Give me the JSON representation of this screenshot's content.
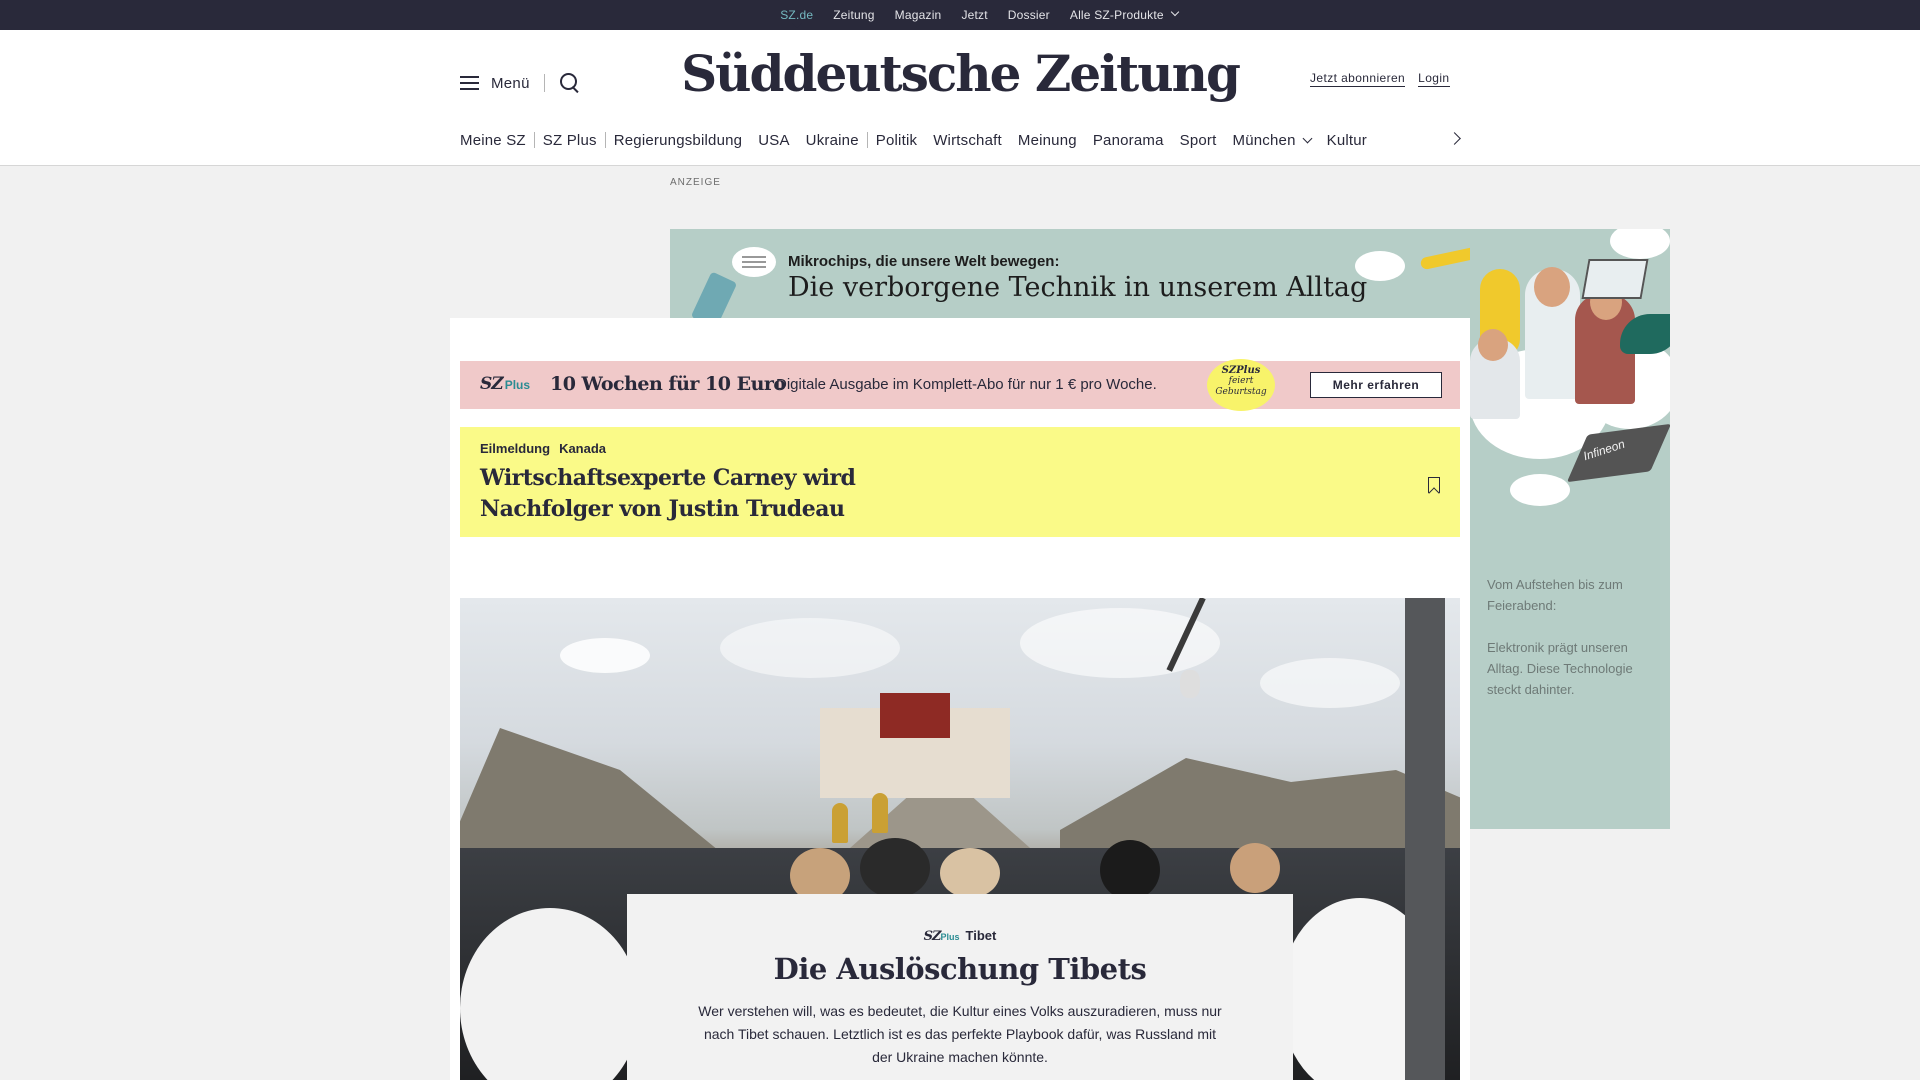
{
  "topbar": {
    "links": [
      {
        "label": "SZ.de",
        "active": true
      },
      {
        "label": "Zeitung"
      },
      {
        "label": "Magazin"
      },
      {
        "label": "Jetzt"
      },
      {
        "label": "Dossier"
      },
      {
        "label": "Alle SZ-Produkte",
        "has_dropdown": true
      }
    ]
  },
  "header": {
    "menu_label": "Menü",
    "logo": "Süddeutsche Zeitung",
    "subscribe_label": "Jetzt abonnieren",
    "login_label": "Login"
  },
  "nav": {
    "items": [
      "Meine SZ",
      "SZ Plus",
      "Regierungsbildung",
      "USA",
      "Ukraine",
      "Politik",
      "Wirtschaft",
      "Meinung",
      "Panorama",
      "Sport",
      "München",
      "Kultur"
    ]
  },
  "ad": {
    "label": "ANZEIGE",
    "leader_small": "Mikrochips, die unsere Welt bewegen:",
    "leader_big": "Die verborgene Technik in unserem Alltag",
    "sky_logo": "Infineon",
    "sky_text_1": "Vom Aufstehen bis zum Feierabend:",
    "sky_text_2": "Elektronik prägt unseren Alltag. Diese Technologie steckt dahinter.",
    "colors": {
      "background": "#b6cec7"
    }
  },
  "promo": {
    "brand": "SZ",
    "brand_suffix": "Plus",
    "title": "10 Wochen für 10 Euro",
    "subtitle": "Digitale Ausgabe im Komplett-Abo für nur 1 € pro Woche.",
    "badge_brand": "SZPlus",
    "badge_text": "feiert Geburtstag",
    "button_label": "Mehr erfahren",
    "colors": {
      "background": "#f0c9c9",
      "badge": "#f8f36a"
    }
  },
  "breaking": {
    "tag": "Eilmeldung",
    "topic": "Kanada",
    "title": "Wirtschaftsexperte Carney wird Nachfolger von Justin Trudeau",
    "colors": {
      "background": "#fafa88"
    }
  },
  "story": {
    "brand": "SZ",
    "brand_suffix": "Plus",
    "kicker": "Tibet",
    "title": "Die Auslöschung Tibets",
    "teaser": "Wer verstehen will, was es bedeutet, die Kultur eines Volks auszuradieren, muss nur nach Tibet schauen. Letztlich ist es das perfekte Playbook dafür, was Russland mit der Ukraine machen könnte."
  },
  "colors": {
    "dark": "#29293a",
    "accent": "#74b8c0",
    "page_bg": "#f1f1f1"
  }
}
